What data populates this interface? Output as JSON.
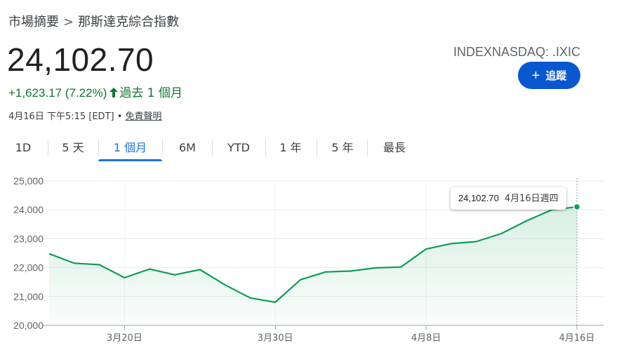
{
  "breadcrumb": {
    "parent": "市場摘要",
    "separator": ">",
    "current": "那斯達克綜合指數"
  },
  "quote": {
    "price": "24,102.70",
    "ticker": "INDEXNASDAQ: .IXIC",
    "change": "+1,623.17 (7.22%)",
    "change_arrow_icon": "arrow-up-icon",
    "change_period": "過去 1 個月",
    "timestamp": "4月16日 下午5:15 [EDT]",
    "bullet": "•",
    "disclaimer": "免責聲明",
    "positive_color": "#137333"
  },
  "follow": {
    "icon": "plus-icon",
    "label": "追蹤",
    "color": "#0b57d0"
  },
  "tabs": [
    {
      "label": "1D",
      "active": false
    },
    {
      "label": "5 天",
      "active": false
    },
    {
      "label": "1 個月",
      "active": true
    },
    {
      "label": "6M",
      "active": false
    },
    {
      "label": "YTD",
      "active": false
    },
    {
      "label": "1 年",
      "active": false
    },
    {
      "label": "5 年",
      "active": false
    },
    {
      "label": "最長",
      "active": false
    }
  ],
  "tooltip": {
    "value": "24,102.70",
    "date": "4月16日週四"
  },
  "chart_data": {
    "type": "area",
    "line_color": "#0f9d58",
    "x_ticks": [
      {
        "label": "3月20日",
        "index": 3
      },
      {
        "label": "3月30日",
        "index": 9
      },
      {
        "label": "4月8日",
        "index": 15
      },
      {
        "label": "4月16日",
        "index": 21
      }
    ],
    "y_ticks": [
      "25,000",
      "24,000",
      "23,000",
      "22,000",
      "21,000",
      "20,000"
    ],
    "y_tick_values": [
      25000,
      24000,
      23000,
      22000,
      21000,
      20000
    ],
    "ylim": [
      20000,
      25000
    ],
    "values": [
      22480,
      22150,
      22100,
      21650,
      21950,
      21750,
      21930,
      21400,
      20950,
      20800,
      21580,
      21850,
      21880,
      21990,
      22020,
      22640,
      22830,
      22900,
      23180,
      23620,
      24000,
      24102.7
    ],
    "grid": true
  }
}
